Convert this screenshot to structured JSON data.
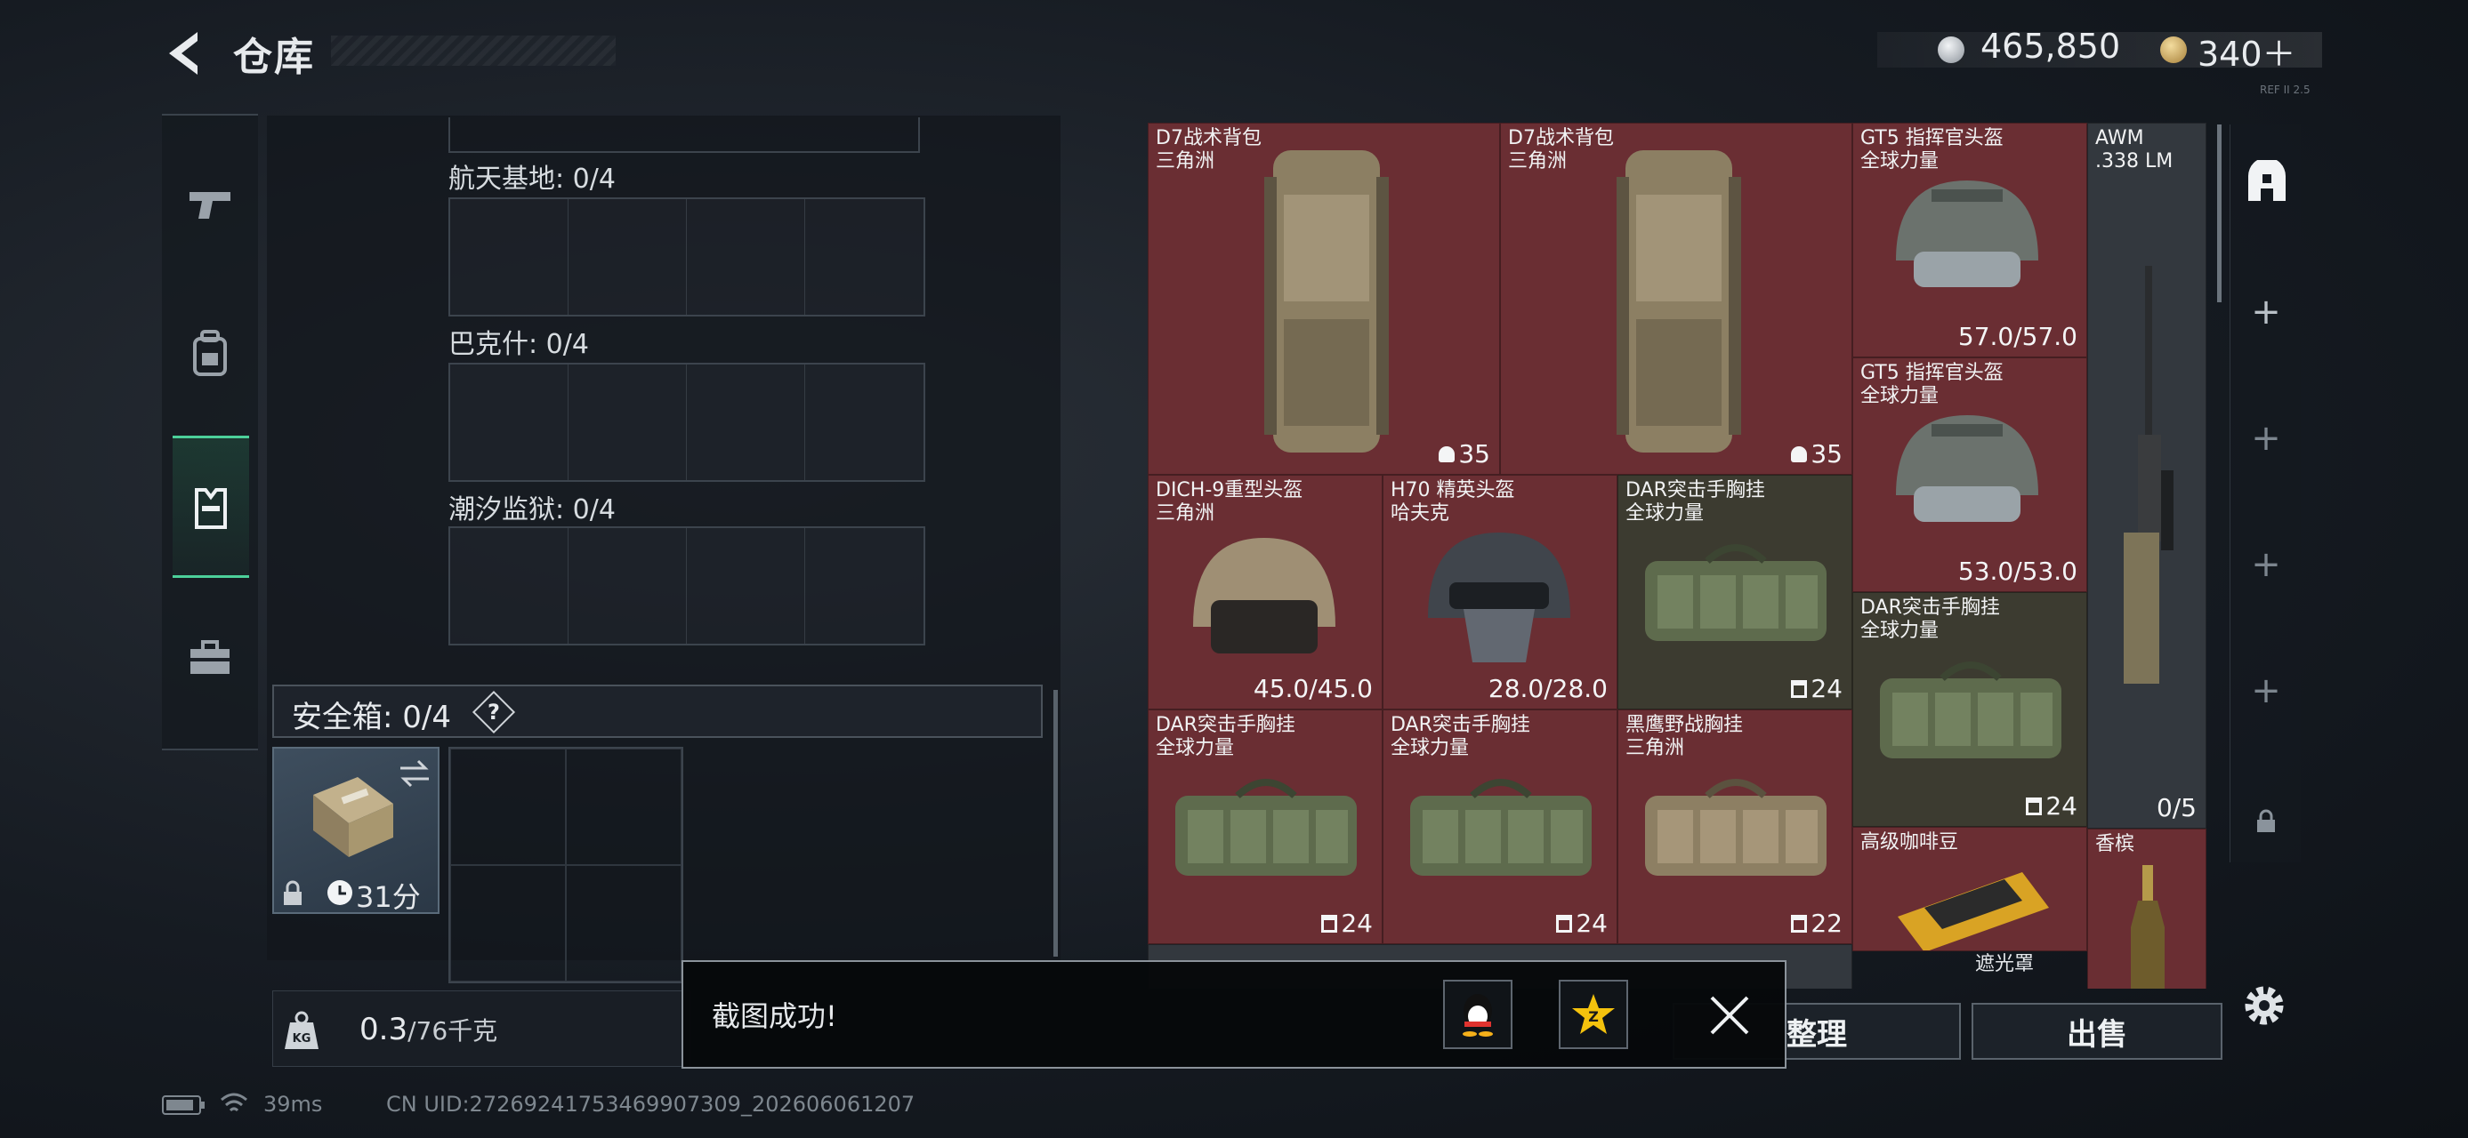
{
  "header": {
    "title": "仓库",
    "currency_silver": "465,850",
    "currency_gold": "340＋",
    "version": "REF II 2.5"
  },
  "nav": {
    "items": [
      "weapon-icon",
      "backpack-icon",
      "vest-icon",
      "toolbox-icon"
    ],
    "active_index": 2
  },
  "left_panel": {
    "sections": [
      {
        "label": "航天基地: 0/4"
      },
      {
        "label": "巴克什: 0/4"
      },
      {
        "label": "潮汐监狱: 0/4"
      }
    ],
    "safe_box": {
      "label": "安全箱:  0/4",
      "help": "?",
      "timer": "31分"
    },
    "weight": {
      "current": "0.3",
      "max": "/76千克"
    }
  },
  "inventory": {
    "items": [
      {
        "name": "D7战术背包",
        "sub": "三角洲",
        "value": "35"
      },
      {
        "name": "D7战术背包",
        "sub": "三角洲",
        "value": "35"
      },
      {
        "name": "GT5 指挥官头盔",
        "sub": "全球力量",
        "value": "57.0/57.0"
      },
      {
        "name": "AWM",
        "sub": ".338 LM",
        "value": "0/5"
      },
      {
        "name": "GT5 指挥官头盔",
        "sub": "全球力量",
        "value": "53.0/53.0"
      },
      {
        "name": "DICH-9重型头盔",
        "sub": "三角洲",
        "value": "45.0/45.0"
      },
      {
        "name": "H70 精英头盔",
        "sub": "哈夫克",
        "value": "28.0/28.0"
      },
      {
        "name": "DAR突击手胸挂",
        "sub": "全球力量",
        "value": "24"
      },
      {
        "name": "DAR突击手胸挂",
        "sub": "全球力量",
        "value": "24"
      },
      {
        "name": "DAR突击手胸挂",
        "sub": "全球力量",
        "value": "24"
      },
      {
        "name": "DAR突击手胸挂",
        "sub": "全球力量",
        "value": "24"
      },
      {
        "name": "黑鹰野战胸挂",
        "sub": "三角洲",
        "value": "22"
      },
      {
        "name": "高级咖啡豆",
        "sub": "",
        "value": ""
      },
      {
        "name": "香槟",
        "sub": "",
        "value": ""
      },
      {
        "name": "遮光罩",
        "sub": "",
        "value": ""
      }
    ]
  },
  "buttons": {
    "organize": "整理",
    "sell": "出售"
  },
  "toast": {
    "message": "截图成功!"
  },
  "status": {
    "ping": "39ms",
    "uid": "CN UID:27269241753469907309_202606061207"
  },
  "colors": {
    "accent_green": "#4cd09a",
    "cell_red": "#6a2e33",
    "cell_olive": "#3c3b30"
  }
}
